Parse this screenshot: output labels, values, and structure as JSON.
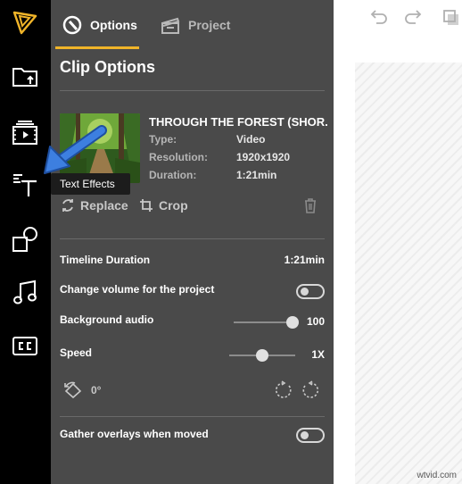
{
  "tabs": [
    {
      "label": "Options",
      "icon": "options-icon",
      "active": true
    },
    {
      "label": "Project",
      "icon": "clapperboard-icon",
      "active": false
    }
  ],
  "panel": {
    "title": "Clip Options"
  },
  "clip": {
    "name": "THROUGH THE FOREST (SHOR...",
    "type_label": "Type:",
    "type": "Video",
    "resolution_label": "Resolution:",
    "resolution": "1920x1920",
    "duration_label": "Duration:",
    "duration": "1:21min"
  },
  "actions": {
    "replace": "Replace",
    "crop": "Crop"
  },
  "settings": {
    "timeline_duration_label": "Timeline Duration",
    "timeline_duration": "1:21min",
    "change_volume_label": "Change volume for the project",
    "change_volume_on": false,
    "background_audio_label": "Background audio",
    "background_audio_value": "100",
    "background_audio_level": 100,
    "speed_label": "Speed",
    "speed_value": "1X",
    "speed_level": 0.5,
    "rotation_value": "0°",
    "gather_overlays_label": "Gather overlays when moved",
    "gather_overlays_on": false
  },
  "tooltip": {
    "text": "Text Effects"
  },
  "sidebar_icons": [
    "logo-icon",
    "upload-folder-icon",
    "media-icon",
    "text-effects-icon",
    "shapes-icon",
    "music-icon",
    "captions-icon"
  ],
  "watermark": "wtvid.com",
  "colors": {
    "panel_bg": "#4a4a4a",
    "rail_bg": "#000000",
    "accent": "#f0b429",
    "arrow": "#3d7fe0"
  }
}
